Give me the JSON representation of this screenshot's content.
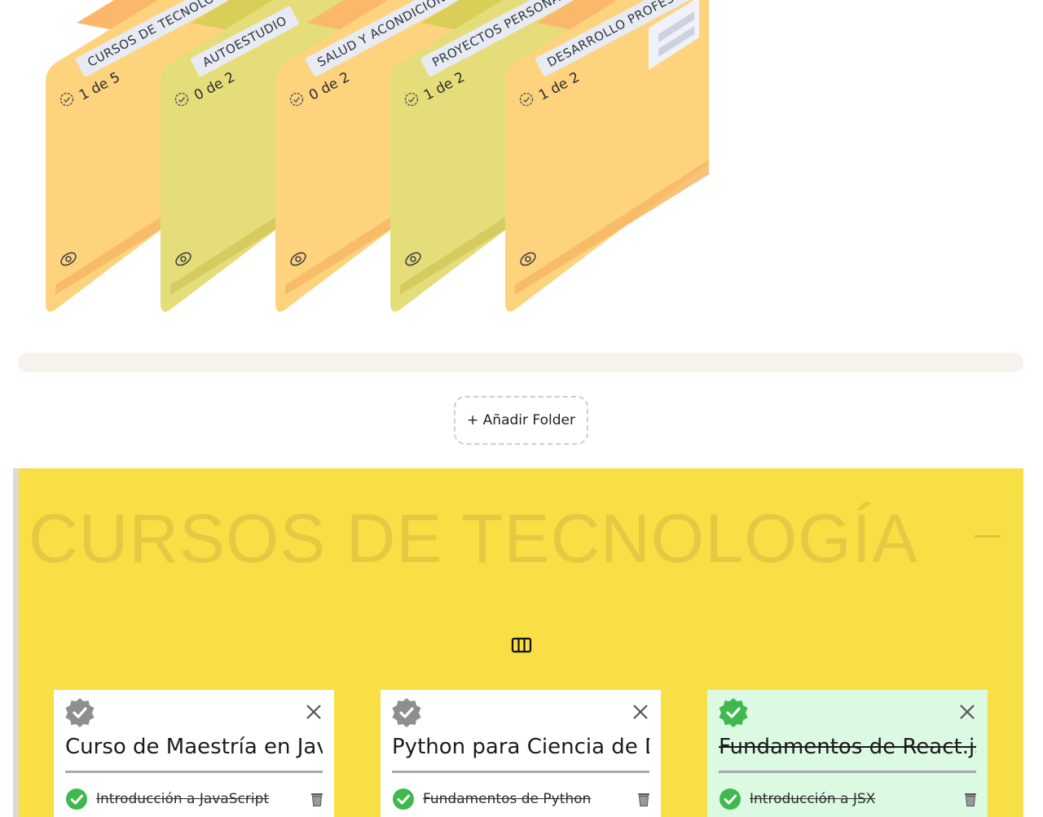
{
  "folders": [
    {
      "tab": "CURSOS DE TECNOLOGÍA",
      "count": "1 de 5",
      "color": "#fdd37e",
      "tab_color": "#fbb86b"
    },
    {
      "tab": "AUTOESTUDIO",
      "count": "0 de 2",
      "color": "#e4dd79",
      "tab_color": "#d9cf58"
    },
    {
      "tab": "SALUD Y ACONDICIONAMIENTO",
      "count": "0 de 2",
      "color": "#fdd37e",
      "tab_color": "#fbb86b"
    },
    {
      "tab": "PROYECTOS PERSONALES",
      "count": "1 de 2",
      "color": "#e4dd79",
      "tab_color": "#d9cf58"
    },
    {
      "tab": "DESARROLLO PROFESIONAL",
      "count": "1 de 2",
      "color": "#fdd37e",
      "tab_color": "#fbb86b"
    }
  ],
  "add_folder_label": "+ Añadir Folder",
  "section": {
    "title": "CURSOS DE TECNOLOGÍA",
    "bg_color": "#f8df45"
  },
  "cards": [
    {
      "title": "Curso de Maestría en JavaScript",
      "completed": false,
      "task": "Introducción a JavaScript",
      "task_done": true
    },
    {
      "title": "Python para Ciencia de Datos",
      "completed": false,
      "task": "Fundamentos de Python",
      "task_done": true
    },
    {
      "title": "Fundamentos de React.js",
      "completed": true,
      "task": "Introducción a JSX",
      "task_done": true
    }
  ],
  "icons": {
    "count": "badge-check-icon",
    "view": "eye-icon",
    "collapse": "minus-icon",
    "columns": "columns-icon",
    "close": "close-icon",
    "delete": "trash-icon"
  }
}
